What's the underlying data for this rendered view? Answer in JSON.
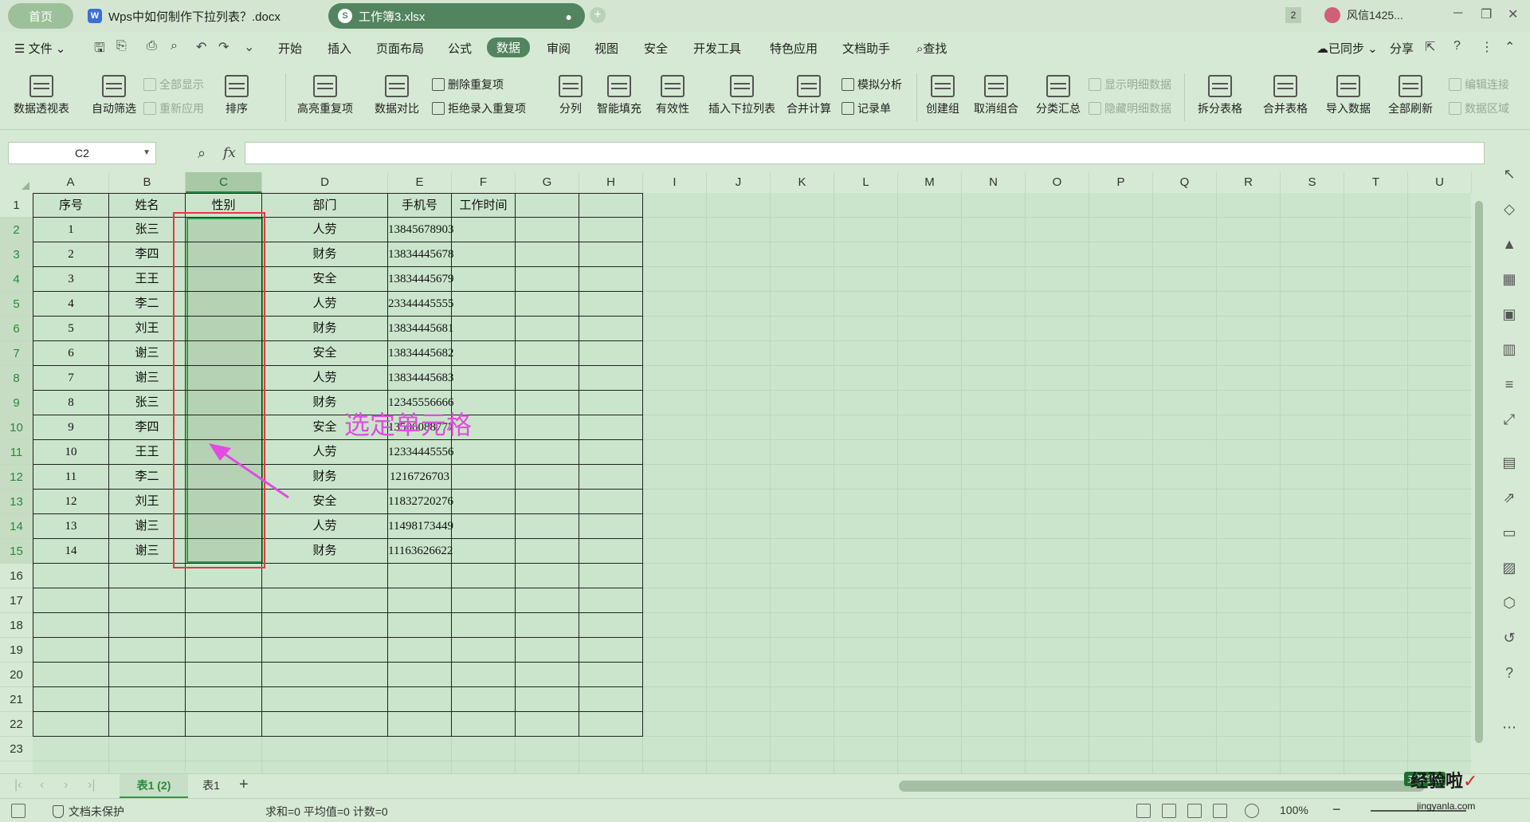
{
  "titlebar": {
    "home_tab": "首页",
    "doc_tab": "Wps中如何制作下拉列表？.docx",
    "xls_tab": "工作簿3.xlsx",
    "badge_count": "2",
    "user_name": "风信1425...",
    "new_tab": "+"
  },
  "menubar": {
    "file": "文件",
    "items": [
      "开始",
      "插入",
      "页面布局",
      "公式",
      "数据",
      "审阅",
      "视图",
      "安全",
      "开发工具",
      "特色应用",
      "文档助手"
    ],
    "search": "查找",
    "sync": "已同步",
    "share": "分享"
  },
  "ribbon": {
    "pivot": "数据透视表",
    "autofilter": "自动筛选",
    "show_all": "全部显示",
    "reapply": "重新应用",
    "sort": "排序",
    "highlight_dup": "高亮重复项",
    "data_compare": "数据对比",
    "remove_dup": "删除重复项",
    "reject_dup": "拒绝录入重复项",
    "split": "分列",
    "smart_fill": "智能填充",
    "validity": "有效性",
    "insert_dropdown": "插入下拉列表",
    "consolidate": "合并计算",
    "what_if": "模拟分析",
    "record_form": "记录单",
    "group": "创建组",
    "ungroup": "取消组合",
    "subtotal": "分类汇总",
    "show_detail": "显示明细数据",
    "hide_detail": "隐藏明细数据",
    "split_table": "拆分表格",
    "merge_table": "合并表格",
    "import_data": "导入数据",
    "refresh_all": "全部刷新",
    "edit_link": "编辑连接",
    "data_area": "数据区域"
  },
  "formula_bar": {
    "name_box": "C2",
    "fx": "fx",
    "formula": ""
  },
  "columns": [
    "A",
    "B",
    "C",
    "D",
    "E",
    "F",
    "G",
    "H",
    "I",
    "J",
    "K",
    "L",
    "M",
    "N",
    "O",
    "P",
    "Q",
    "R",
    "S",
    "T",
    "U"
  ],
  "rows": [
    "1",
    "2",
    "3",
    "4",
    "5",
    "6",
    "7",
    "8",
    "9",
    "10",
    "11",
    "12",
    "13",
    "14",
    "15",
    "16",
    "17",
    "18",
    "19",
    "20",
    "21",
    "22",
    "23"
  ],
  "table": {
    "headers": [
      "序号",
      "姓名",
      "性别",
      "部门",
      "手机号",
      "工作时间"
    ],
    "rows": [
      [
        "1",
        "张三",
        "",
        "人劳",
        "13845678903",
        ""
      ],
      [
        "2",
        "李四",
        "",
        "财务",
        "13834445678",
        ""
      ],
      [
        "3",
        "王王",
        "",
        "安全",
        "13834445679",
        ""
      ],
      [
        "4",
        "李二",
        "",
        "人劳",
        "23344445555",
        ""
      ],
      [
        "5",
        "刘王",
        "",
        "财务",
        "13834445681",
        ""
      ],
      [
        "6",
        "谢三",
        "",
        "安全",
        "13834445682",
        ""
      ],
      [
        "7",
        "谢三",
        "",
        "人劳",
        "13834445683",
        ""
      ],
      [
        "8",
        "张三",
        "",
        "财务",
        "12345556666",
        ""
      ],
      [
        "9",
        "李四",
        "",
        "安全",
        "13500088777",
        ""
      ],
      [
        "10",
        "王王",
        "",
        "人劳",
        "12334445556",
        ""
      ],
      [
        "11",
        "李二",
        "",
        "财务",
        "1216726703",
        ""
      ],
      [
        "12",
        "刘王",
        "",
        "安全",
        "11832720276",
        ""
      ],
      [
        "13",
        "谢三",
        "",
        "人劳",
        "11498173449",
        ""
      ],
      [
        "14",
        "谢三",
        "",
        "财务",
        "11163626622",
        ""
      ]
    ]
  },
  "annotation": "选定单元格",
  "sheet_tabs": [
    "表1 (2)",
    "表1"
  ],
  "statusbar": {
    "protect": "文档未保护",
    "stats": "求和=0  平均值=0  计数=0",
    "zoom": "100%"
  },
  "watermark": {
    "text": "经验啦",
    "check": "✓",
    "url": "jingyanla.com",
    "badge": "五笔字型"
  },
  "colors": {
    "accent": "#52855f",
    "selection": "#2f9a44",
    "annotation_box": "#ee3344",
    "annotation_text": "#e04de0"
  }
}
